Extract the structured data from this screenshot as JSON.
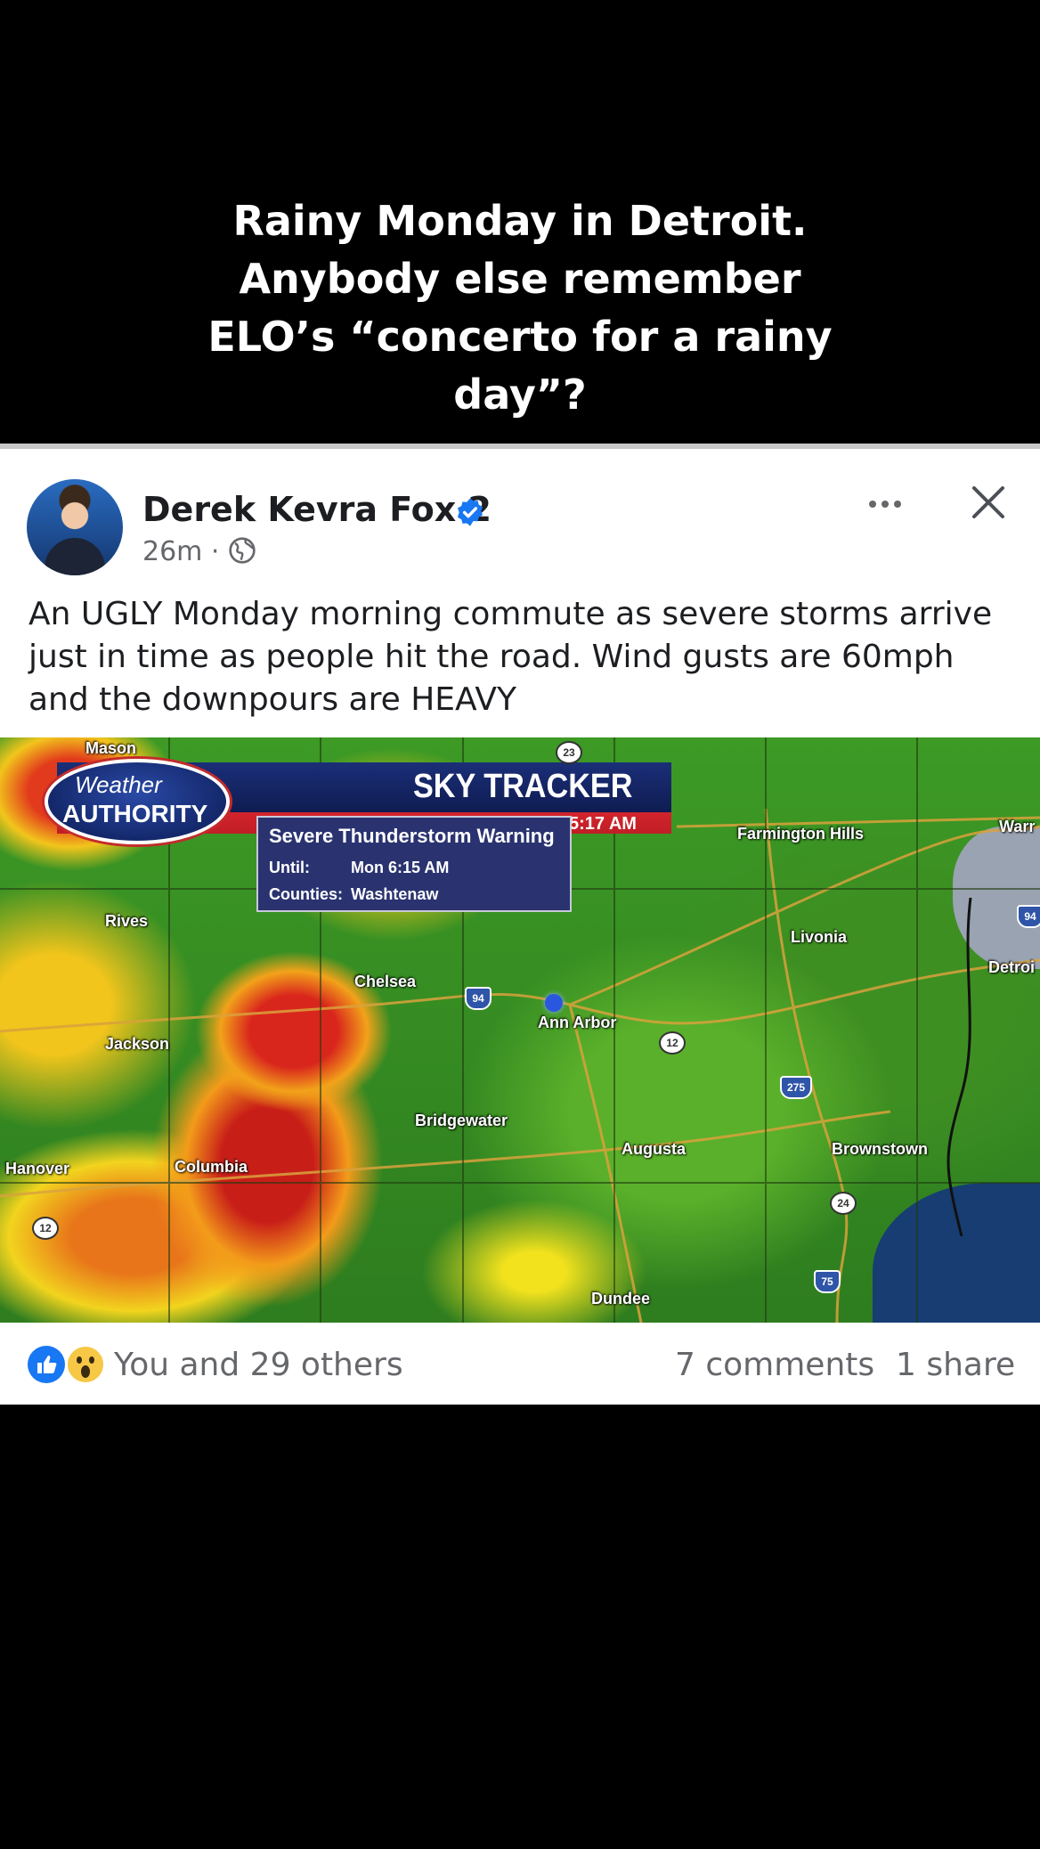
{
  "caption": {
    "lines": [
      "Rainy Monday in Detroit.",
      "Anybody else remember",
      "ELO’s “concerto for a rainy",
      "day”?"
    ]
  },
  "post": {
    "author": "Derek Kevra Fox 2",
    "time": "26m ·",
    "text_lines": [
      "An UGLY Monday morning commute as severe storms arrive",
      "just in time as people hit the road.  Wind gusts are 60mph",
      "and the downpours are HEAVY"
    ],
    "icons": {
      "verified": "verified-badge-icon",
      "audience": "globe-icon",
      "more": "more-icon",
      "close": "close-icon"
    },
    "colors": {
      "verified": "#1877f2",
      "meta": "#65676b",
      "text": "#1c1e21"
    }
  },
  "map": {
    "logo_line1": "Weather",
    "logo_line2": "AUTHORITY",
    "banner_title": "SKY TRACKER",
    "banner_time": "5:17 AM",
    "warning": {
      "title": "Severe Thunderstorm Warning",
      "until_label": "Until:",
      "until_value": "Mon 6:15 AM",
      "counties_label": "Counties:",
      "counties_value": "Washtenaw"
    },
    "labels": {
      "mason": "Mason",
      "farmington": "Farmington Hills",
      "warren": "Warr",
      "rives": "Rives",
      "livonia": "Livonia",
      "detroit": "Detroi",
      "chelsea": "Chelsea",
      "ann_arbor": "Ann Arbor",
      "jackson": "Jackson",
      "bridgewater": "Bridgewater",
      "augusta": "Augusta",
      "brownstown": "Brownstown",
      "hanover": "Hanover",
      "columbia": "Columbia",
      "dundee": "Dundee"
    },
    "shields": {
      "s23": "23",
      "s94a": "94",
      "s94b": "94",
      "s12a": "12",
      "s12b": "12",
      "s275": "275",
      "s24": "24",
      "s75": "75"
    }
  },
  "engagement": {
    "reactions": "You and 29 others",
    "comments": "7 comments",
    "shares": "1 share",
    "icons": {
      "like": "like-icon",
      "wow": "wow-icon"
    }
  }
}
